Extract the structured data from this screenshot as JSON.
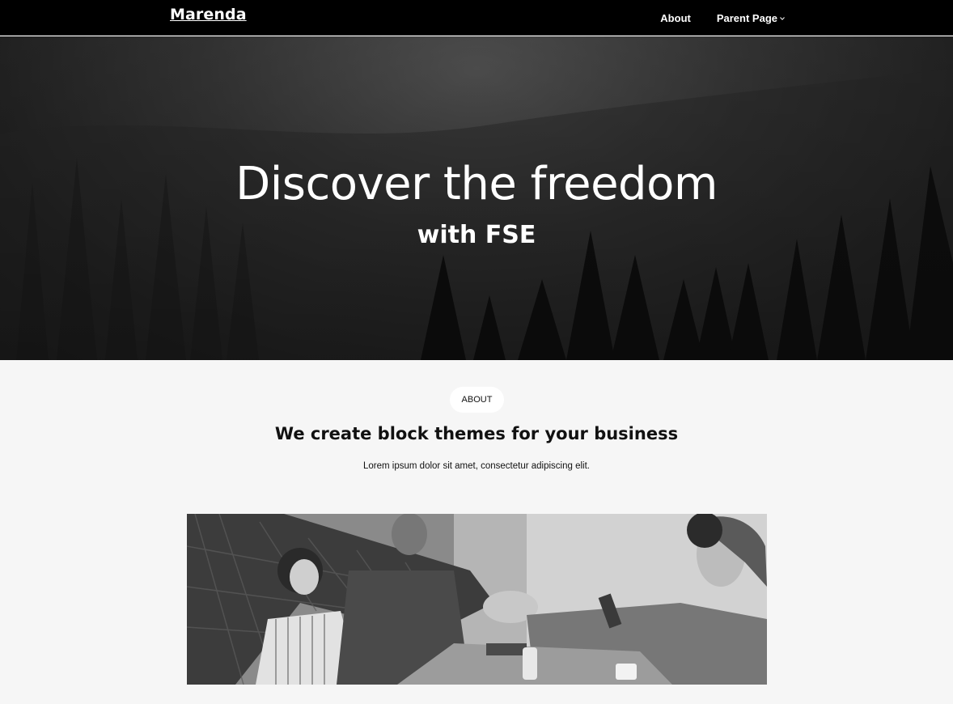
{
  "header": {
    "site_title": "Marenda",
    "nav": [
      {
        "label": "About"
      },
      {
        "label": "Parent Page",
        "has_submenu": true
      }
    ]
  },
  "hero": {
    "title": "Discover the freedom",
    "subtitle": "with FSE"
  },
  "about": {
    "badge": "ABOUT",
    "heading": "We create block themes for your business",
    "text": "Lorem ipsum dolor sit amet, consectetur adipiscing elit."
  },
  "colors": {
    "header_bg": "#000000",
    "page_bg": "#f6f6f6",
    "text": "#111111"
  }
}
